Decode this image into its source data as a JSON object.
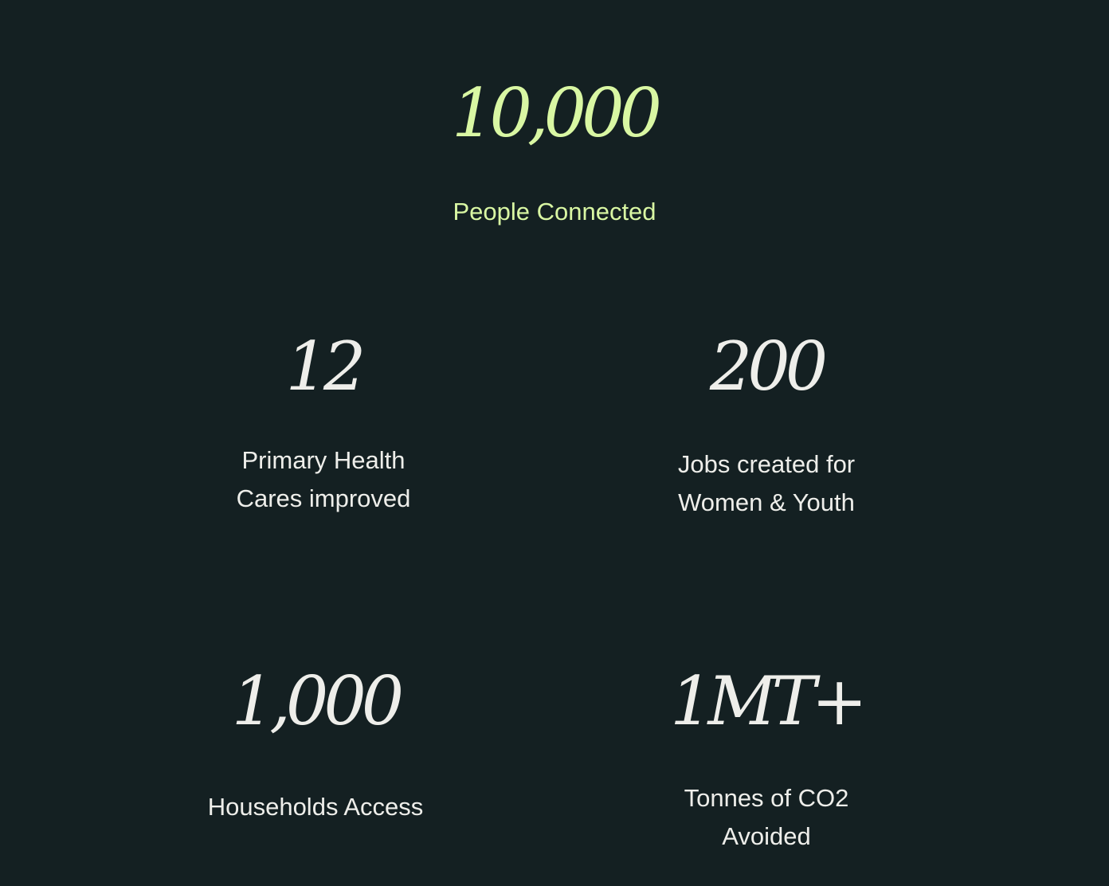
{
  "hero": {
    "value": "10,000",
    "label": "People Connected"
  },
  "stats": [
    {
      "value": "12",
      "label_lines": [
        "Primary Health",
        "Cares improved"
      ]
    },
    {
      "value": "200",
      "label_lines": [
        "Jobs created for",
        "Women & Youth"
      ]
    },
    {
      "value": "1,000",
      "label_lines": [
        "Households Access"
      ]
    },
    {
      "value": "1MT+",
      "label_lines": [
        "Tonnes of CO2",
        "Avoided"
      ]
    }
  ],
  "colors": {
    "background": "#142022",
    "accent": "#d9f7a3",
    "text": "#eeeeea"
  }
}
